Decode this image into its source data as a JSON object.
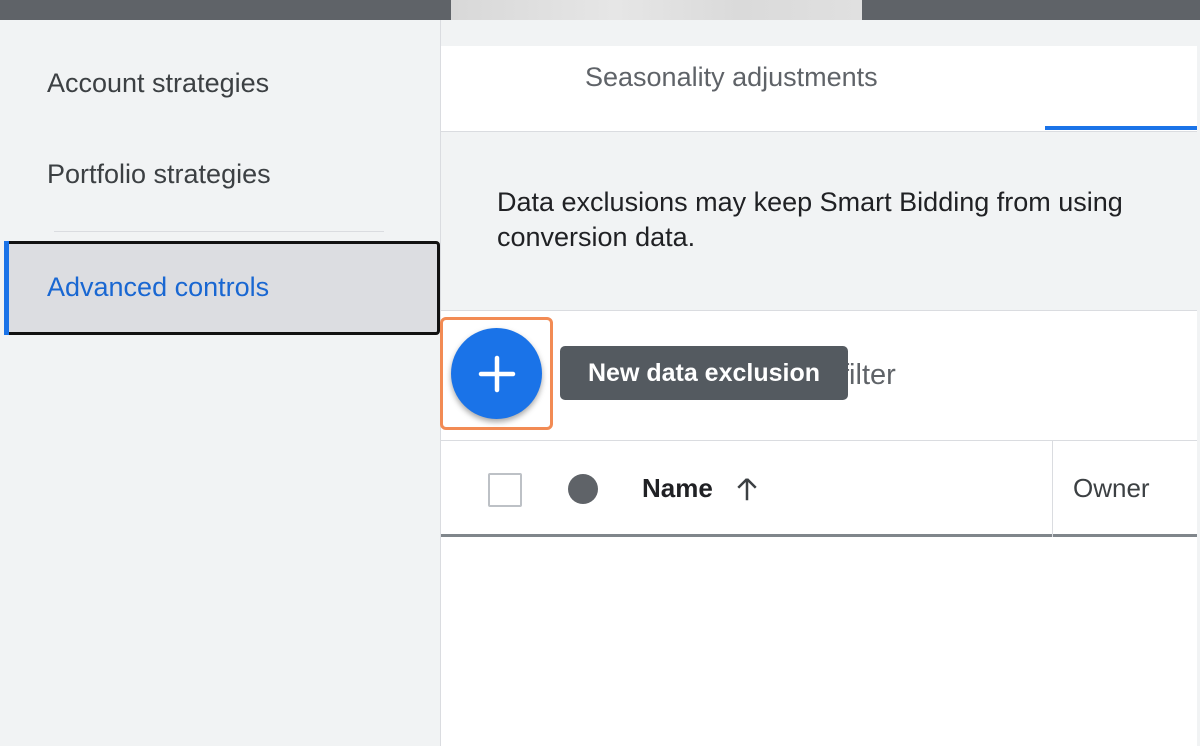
{
  "sidebar": {
    "items": [
      {
        "label": "Account strategies"
      },
      {
        "label": "Portfolio strategies"
      },
      {
        "label": "Advanced controls",
        "active": true
      }
    ]
  },
  "tabs": {
    "active_label": "Seasonality adjustments"
  },
  "notice": {
    "line1": "Data exclusions may keep Smart Bidding from using",
    "line2": "conversion data."
  },
  "toolbar": {
    "add_button_icon": "plus-icon",
    "tooltip": "New data exclusion",
    "filter_label": "filter"
  },
  "table": {
    "columns": [
      "Name",
      "Owner"
    ],
    "sort_icon": "arrow-up-icon",
    "status_icon": "status-dot-icon"
  },
  "colors": {
    "accent": "#1a73e8",
    "highlight": "#f28b54",
    "tooltip_bg": "#545a60"
  }
}
